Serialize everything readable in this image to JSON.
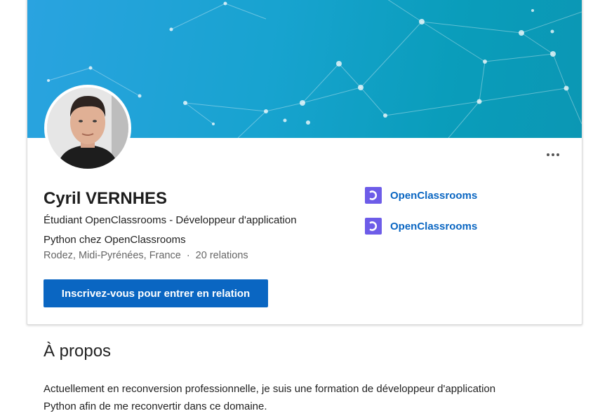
{
  "profile": {
    "name": "Cyril VERNHES",
    "headline_line1": "Étudiant OpenClassrooms - Développeur d'application",
    "headline_line2": "Python chez OpenClassrooms",
    "location": "Rodez, Midi-Pyrénées, France",
    "separator": "·",
    "connections": "20 relations",
    "connect_button": "Inscrivez-vous pour entrer en relation",
    "companies": [
      {
        "name": "OpenClassrooms",
        "icon": "openclassrooms-logo-icon"
      },
      {
        "name": "OpenClassrooms",
        "icon": "openclassrooms-logo-icon"
      }
    ],
    "more_icon": "more-options-icon"
  },
  "about": {
    "title": "À propos",
    "text_line1": "Actuellement en reconversion professionnelle, je suis une formation de développeur d'application",
    "text_line2": "Python afin de me reconvertir dans ce domaine."
  },
  "colors": {
    "banner_start": "#2aa3e0",
    "banner_end": "#0b97b4",
    "button": "#0a66c2",
    "link": "#0a66c2",
    "logo": "#6d5ce8"
  }
}
